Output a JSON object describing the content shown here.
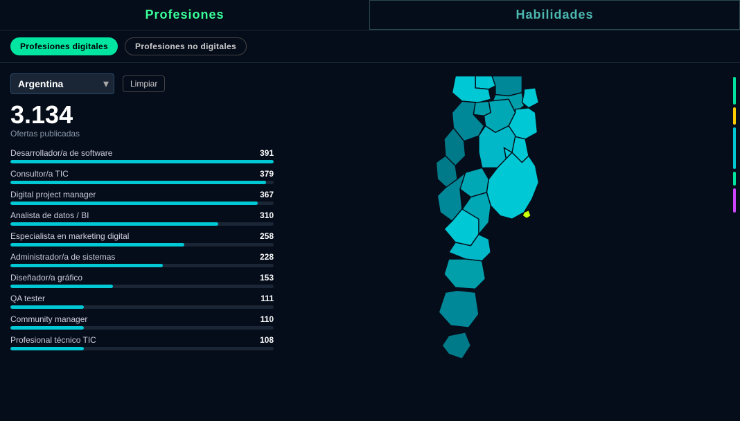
{
  "header": {
    "tab_profesiones": "Profesiones",
    "tab_habilidades": "Habilidades"
  },
  "subtabs": {
    "digital_label": "Profesiones digitales",
    "no_digital_label": "Profesiones no digitales"
  },
  "filter": {
    "country_value": "Argentina",
    "clear_label": "Limpiar"
  },
  "stats": {
    "total": "3.134",
    "label": "Ofertas publicadas"
  },
  "professions": [
    {
      "name": "Desarrollador/a de software",
      "count": 391,
      "pct": 100
    },
    {
      "name": "Consultor/a TIC",
      "count": 379,
      "pct": 97
    },
    {
      "name": "Digital project manager",
      "count": 367,
      "pct": 94
    },
    {
      "name": "Analista de datos / BI",
      "count": 310,
      "pct": 79
    },
    {
      "name": "Especialista en marketing digital",
      "count": 258,
      "pct": 66
    },
    {
      "name": "Administrador/a de sistemas",
      "count": 228,
      "pct": 58
    },
    {
      "name": "Diseñador/a gráfico",
      "count": 153,
      "pct": 39
    },
    {
      "name": "QA tester",
      "count": 111,
      "pct": 28
    },
    {
      "name": "Community manager",
      "count": 110,
      "pct": 28
    },
    {
      "name": "Profesional técnico TIC",
      "count": 108,
      "pct": 28
    }
  ],
  "colors": {
    "accent": "#00e5a0",
    "map_light": "#00c8d4",
    "map_mid": "#008899",
    "map_dark": "#004455",
    "map_highlight": "#ccff00",
    "bar": "#00c8d4",
    "bg": "#060d1a"
  }
}
